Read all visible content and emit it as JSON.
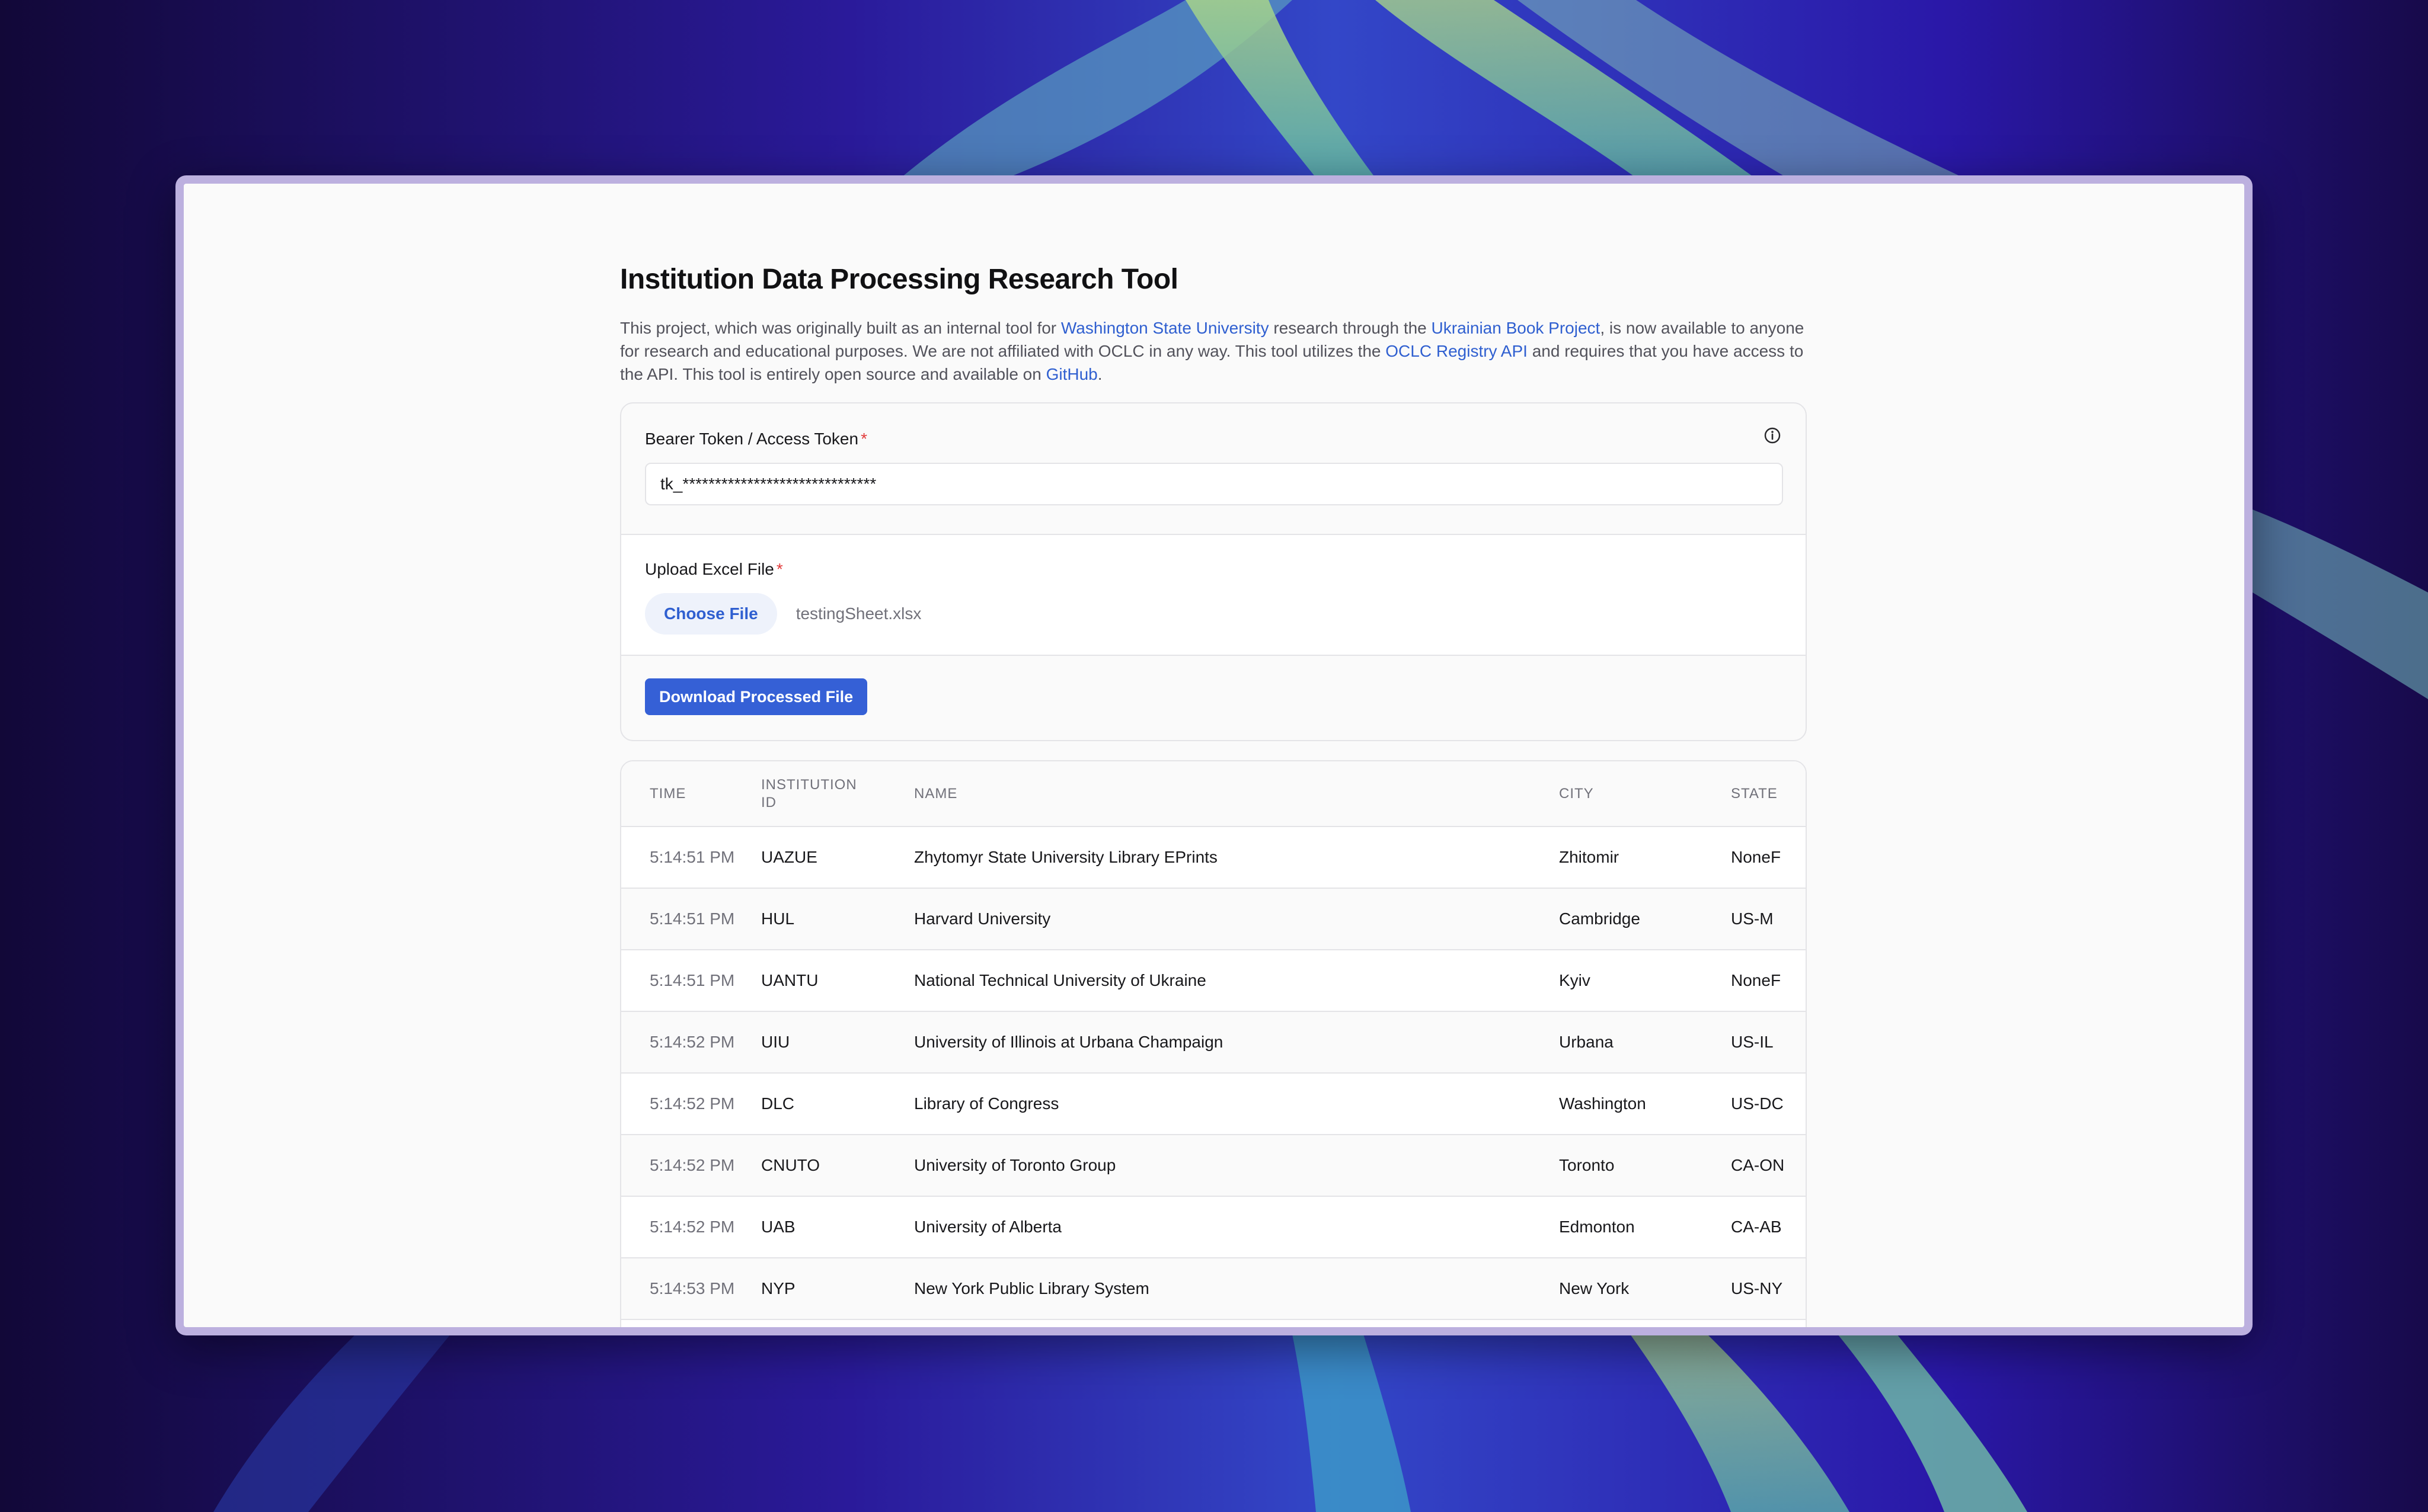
{
  "page": {
    "title": "Institution Data Processing Research Tool",
    "intro": {
      "part1": "This project, which was originally built as an internal tool for ",
      "link1": "Washington State University",
      "part2": " research through the ",
      "link2": "Ukrainian Book Project",
      "part3": ", is now available to anyone for research and educational purposes. We are not affiliated with OCLC in any way. This tool utilizes the ",
      "link3": "OCLC Registry API",
      "part4": " and requires that you have access to the API. This tool is entirely open source and available on ",
      "link4": "GitHub",
      "part5": "."
    }
  },
  "form": {
    "token_label": "Bearer Token / Access Token",
    "required_mark": "*",
    "token_value": "tk_******************************",
    "upload_label": "Upload Excel File",
    "choose_button": "Choose File",
    "file_name": "testingSheet.xlsx",
    "download_button": "Download Processed File"
  },
  "table": {
    "headers": [
      "TIME",
      "INSTITUTION ID",
      "NAME",
      "CITY",
      "STATE"
    ],
    "rows": [
      {
        "time": "5:14:51 PM",
        "id": "UAZUE",
        "name": "Zhytomyr State University Library EPrints",
        "city": "Zhitomir",
        "state": "NoneF"
      },
      {
        "time": "5:14:51 PM",
        "id": "HUL",
        "name": "Harvard University",
        "city": "Cambridge",
        "state": "US-M"
      },
      {
        "time": "5:14:51 PM",
        "id": "UANTU",
        "name": "National Technical University of Ukraine",
        "city": "Kyiv",
        "state": "NoneF"
      },
      {
        "time": "5:14:52 PM",
        "id": "UIU",
        "name": "University of Illinois at Urbana Champaign",
        "city": "Urbana",
        "state": "US-IL"
      },
      {
        "time": "5:14:52 PM",
        "id": "DLC",
        "name": "Library of Congress",
        "city": "Washington",
        "state": "US-DC"
      },
      {
        "time": "5:14:52 PM",
        "id": "CNUTO",
        "name": "University of Toronto Group",
        "city": "Toronto",
        "state": "CA-ON"
      },
      {
        "time": "5:14:52 PM",
        "id": "UAB",
        "name": "University of Alberta",
        "city": "Edmonton",
        "state": "CA-AB"
      },
      {
        "time": "5:14:53 PM",
        "id": "NYP",
        "name": "New York Public Library System",
        "city": "New York",
        "state": "US-NY"
      }
    ]
  },
  "colors": {
    "link": "#2f5fd0",
    "primary_button": "#3560d6",
    "required": "#e23b3b"
  },
  "icons": {
    "info": "info-icon"
  }
}
